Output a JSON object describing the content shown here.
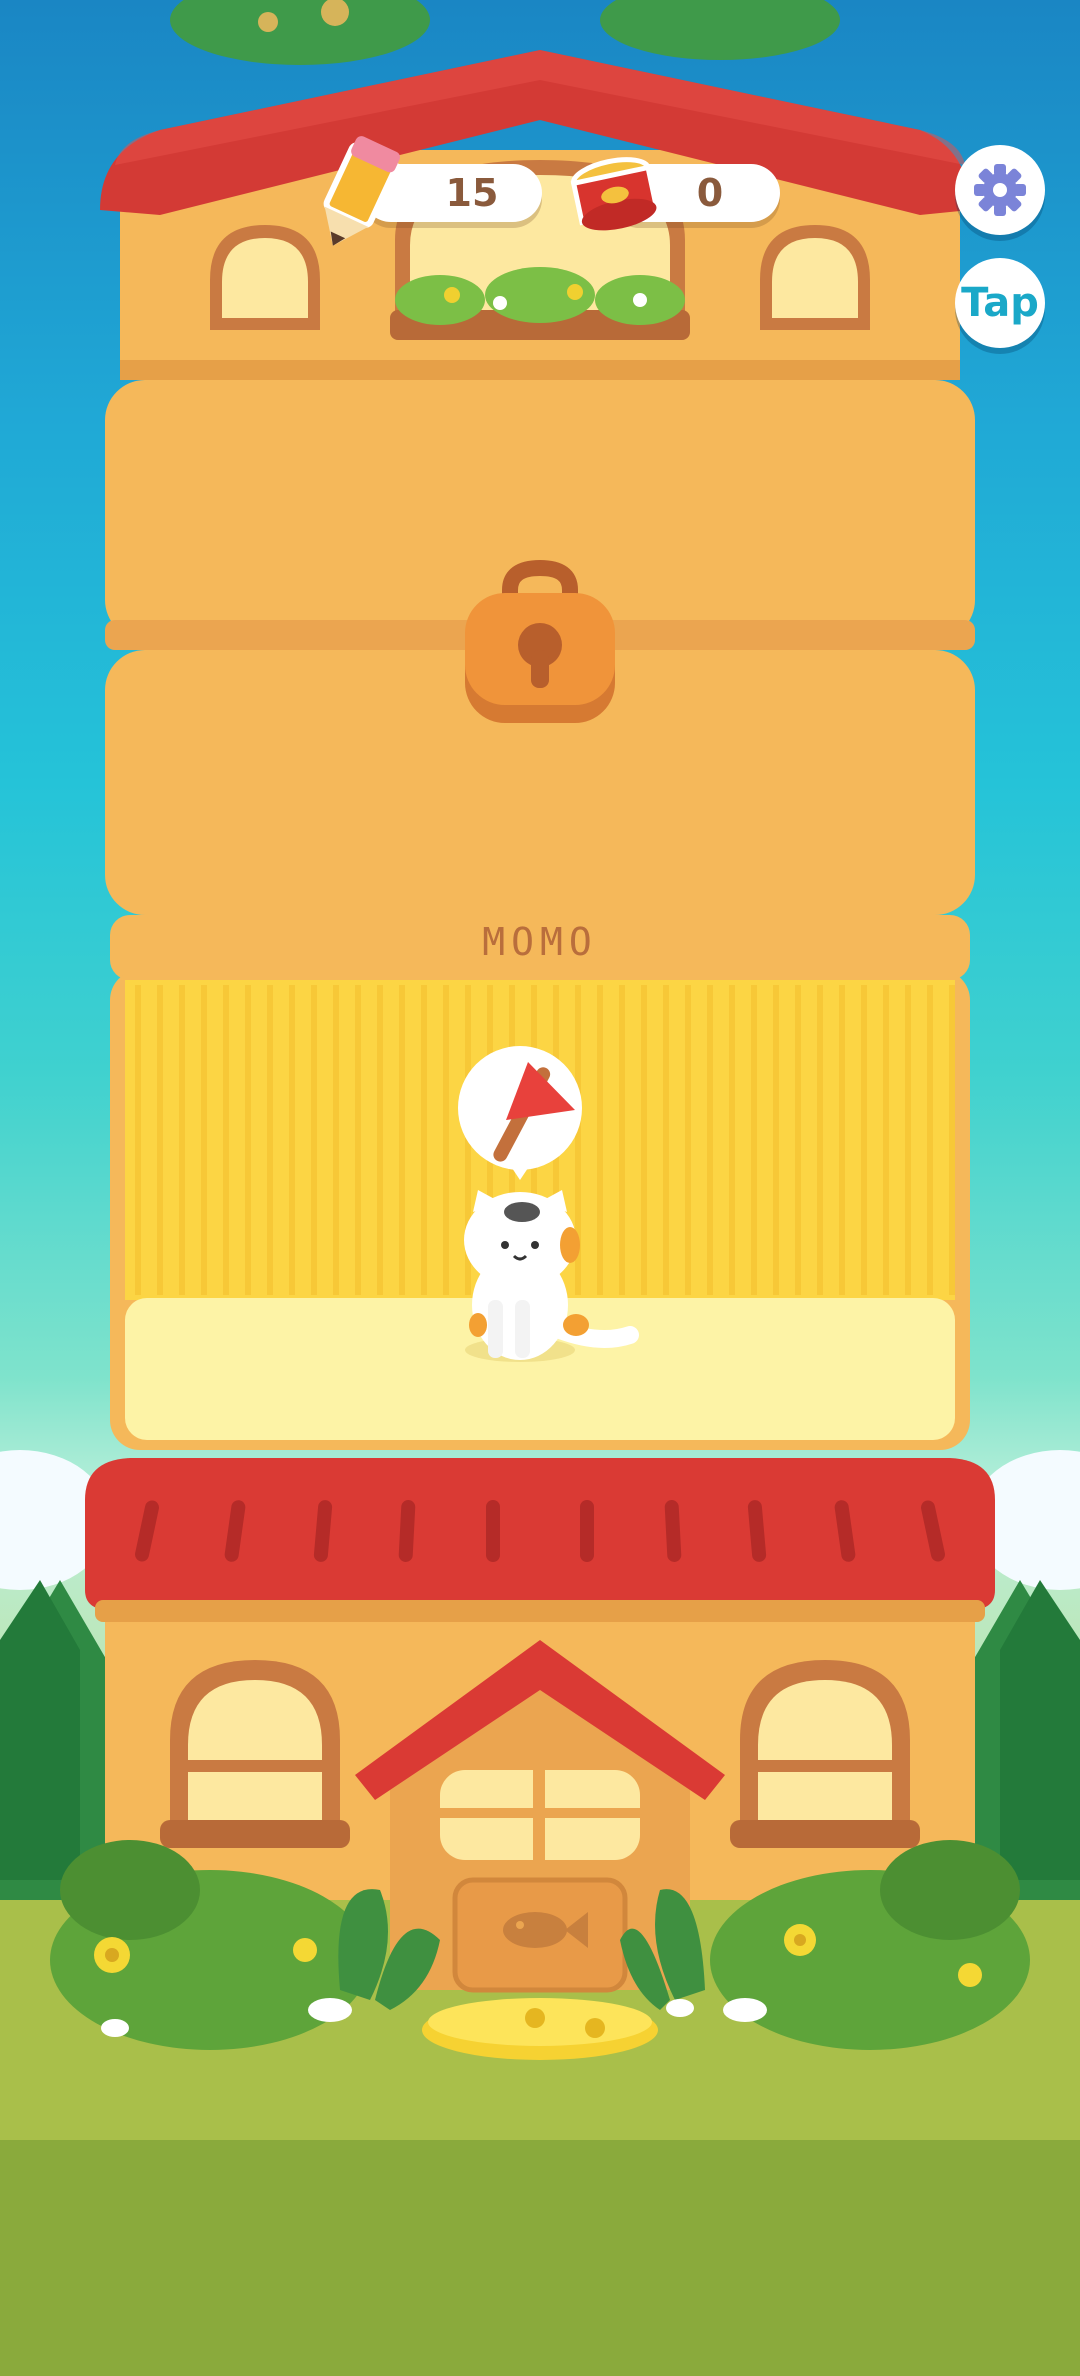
{
  "hud": {
    "pencils": {
      "icon": "pencil-icon",
      "count": "15"
    },
    "cans": {
      "icon": "fish-can-icon",
      "count": "0"
    },
    "settings": {
      "icon": "gear-icon"
    },
    "tap": {
      "label": "Tap"
    }
  },
  "floors": [
    {
      "type": "attic"
    },
    {
      "type": "locked",
      "icon": "padlock-icon"
    },
    {
      "type": "room",
      "name": "MOMO",
      "thought_icon": "flag-icon",
      "cat": "calico-cat"
    },
    {
      "type": "ground",
      "door_icon": "fish-icon"
    }
  ],
  "colors": {
    "roof_red": "#d93a35",
    "wall_orange": "#f5b85a",
    "room_yellow": "#fcd544",
    "text_brown": "#b96e3c"
  }
}
